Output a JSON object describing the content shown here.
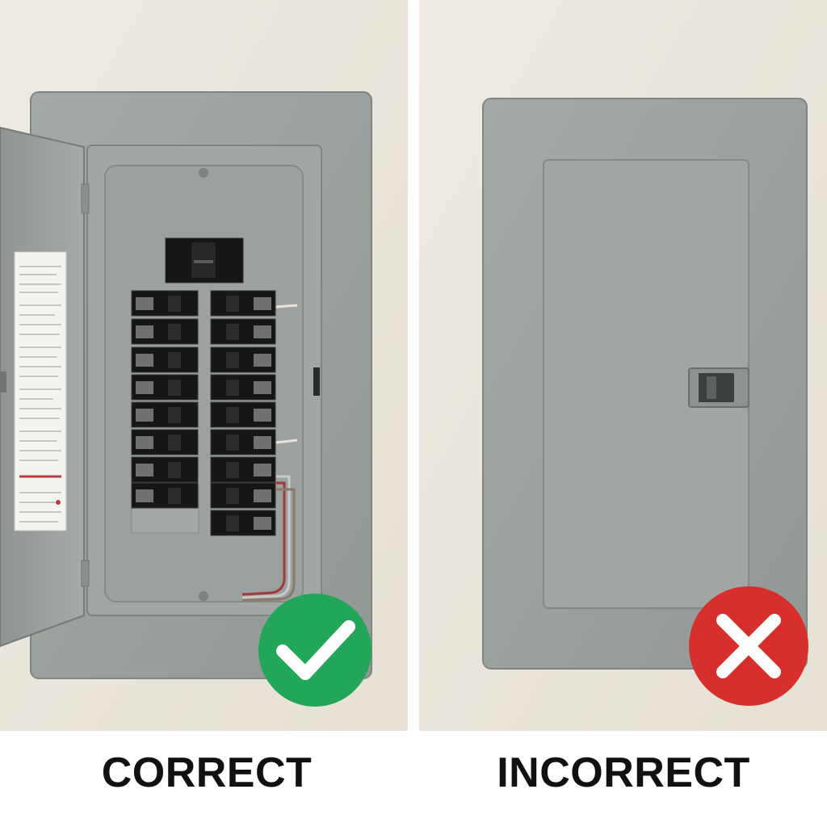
{
  "panels": [
    {
      "label": "CORRECT",
      "status": "correct",
      "badge_icon": "checkmark-icon",
      "badge_color": "#22a65a"
    },
    {
      "label": "INCORRECT",
      "status": "incorrect",
      "badge_icon": "x-mark-icon",
      "badge_color": "#d7302c"
    }
  ],
  "colors": {
    "wall": "#ece7dd",
    "panel_gray": "#9aa09d",
    "breaker_black": "#161616",
    "divider": "#ffffff"
  }
}
